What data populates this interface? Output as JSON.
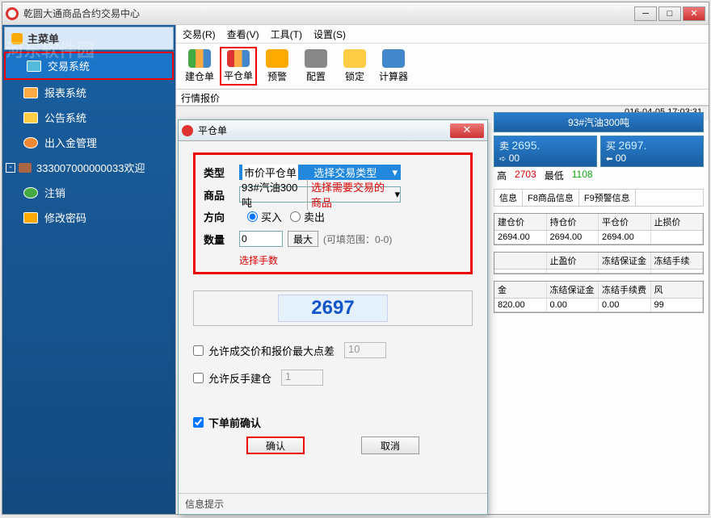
{
  "window": {
    "title": "乾圆大通商品合约交易中心"
  },
  "sidebar": {
    "header": "主菜单",
    "items": [
      {
        "label": "交易系统"
      },
      {
        "label": "报表系统"
      },
      {
        "label": "公告系统"
      },
      {
        "label": "出入金管理"
      }
    ],
    "account": "333007000000033欢迎",
    "subitems": [
      {
        "label": "注销"
      },
      {
        "label": "修改密码"
      }
    ]
  },
  "menu": [
    "交易(R)",
    "查看(V)",
    "工具(T)",
    "设置(S)"
  ],
  "toolbar": [
    "建仓单",
    "平仓单",
    "预警",
    "配置",
    "锁定",
    "计算器"
  ],
  "quote_label": "行情报价",
  "product": {
    "name": "93#汽油300吨",
    "sell_lbl": "卖",
    "sell": "2695.",
    "sell_qty": "00",
    "buy_lbl": "买",
    "buy": "2697.",
    "buy_qty": "00",
    "high_lbl": "高",
    "high": "2703",
    "low_lbl": "最低",
    "low": "1108"
  },
  "tabs": [
    "信息",
    "F8商品信息",
    "F9预警信息"
  ],
  "table1": {
    "head": [
      "建仓价",
      "持仓价",
      "平仓价",
      "止损价"
    ],
    "row": [
      "2694.00",
      "2694.00",
      "2694.00",
      ""
    ]
  },
  "table2": {
    "head": [
      "",
      "止盈价",
      "冻结保证金",
      "冻结手续"
    ]
  },
  "table3": {
    "head": [
      "金",
      "冻结保证金",
      "冻结手续费",
      "风"
    ],
    "row": [
      "820.00",
      "0.00",
      "0.00",
      "99"
    ]
  },
  "dialog": {
    "title": "平仓单",
    "type_lbl": "类型",
    "type_val": "市价平仓单",
    "type_hint": "选择交易类型",
    "prod_lbl": "商品",
    "prod_val": "93#汽油300吨",
    "prod_hint": "选择需要交易的商品",
    "dir_lbl": "方向",
    "dir_buy": "买入",
    "dir_sell": "卖出",
    "qty_lbl": "数量",
    "qty_val": "0",
    "qty_max": "最大",
    "qty_range": "(可填范围：0-0)",
    "qty_tip": "选择手数",
    "price": "2697",
    "opt1": "允许成交价和报价最大点差",
    "opt1_val": "10",
    "opt2": "允许反手建仓",
    "opt2_val": "1",
    "confirm": "下单前确认",
    "ok": "确认",
    "cancel": "取消",
    "info": "信息提示"
  },
  "status": "016-04-05 17:03:31"
}
